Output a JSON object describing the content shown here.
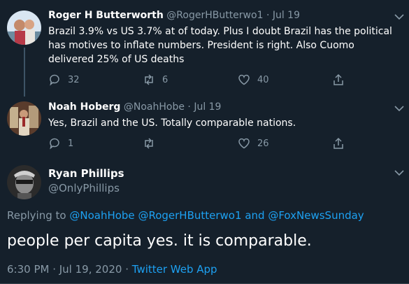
{
  "tweets": [
    {
      "name": "Roger H Butterworth",
      "handle": "@RogerHButterwo1",
      "date": "Jul 19",
      "text": "Brazil 3.9% vs US 3.7% at of today. Plus I doubt Brazil has the political has motives to inflate numbers. President is right. Also Cuomo delivered 25% of US deaths",
      "replies": "32",
      "retweets": "6",
      "likes": "40"
    },
    {
      "name": "Noah Hoberg",
      "handle": "@NoahHobe",
      "date": "Jul 19",
      "text": "Yes, Brazil and the US. Totally comparable nations.",
      "replies": "1",
      "retweets": "",
      "likes": "26"
    }
  ],
  "focus": {
    "name": "Ryan Phillips",
    "handle": "@OnlyPhillips",
    "replying_label": "Replying to",
    "reply_handle_1": "@NoahHobe",
    "reply_handle_2": "@RogerHButterwo1",
    "and_label": "and",
    "reply_handle_3": "@FoxNewsSunday",
    "text": "people per capita yes. it is comparable.",
    "timestamp": "6:30 PM · Jul 19, 2020",
    "dot": "·",
    "source": "Twitter Web App"
  },
  "meta_separator": "·",
  "colors": {
    "background": "#15202b",
    "secondary_text": "#8899a6",
    "link": "#1da1f2",
    "divider": "#38444d"
  }
}
